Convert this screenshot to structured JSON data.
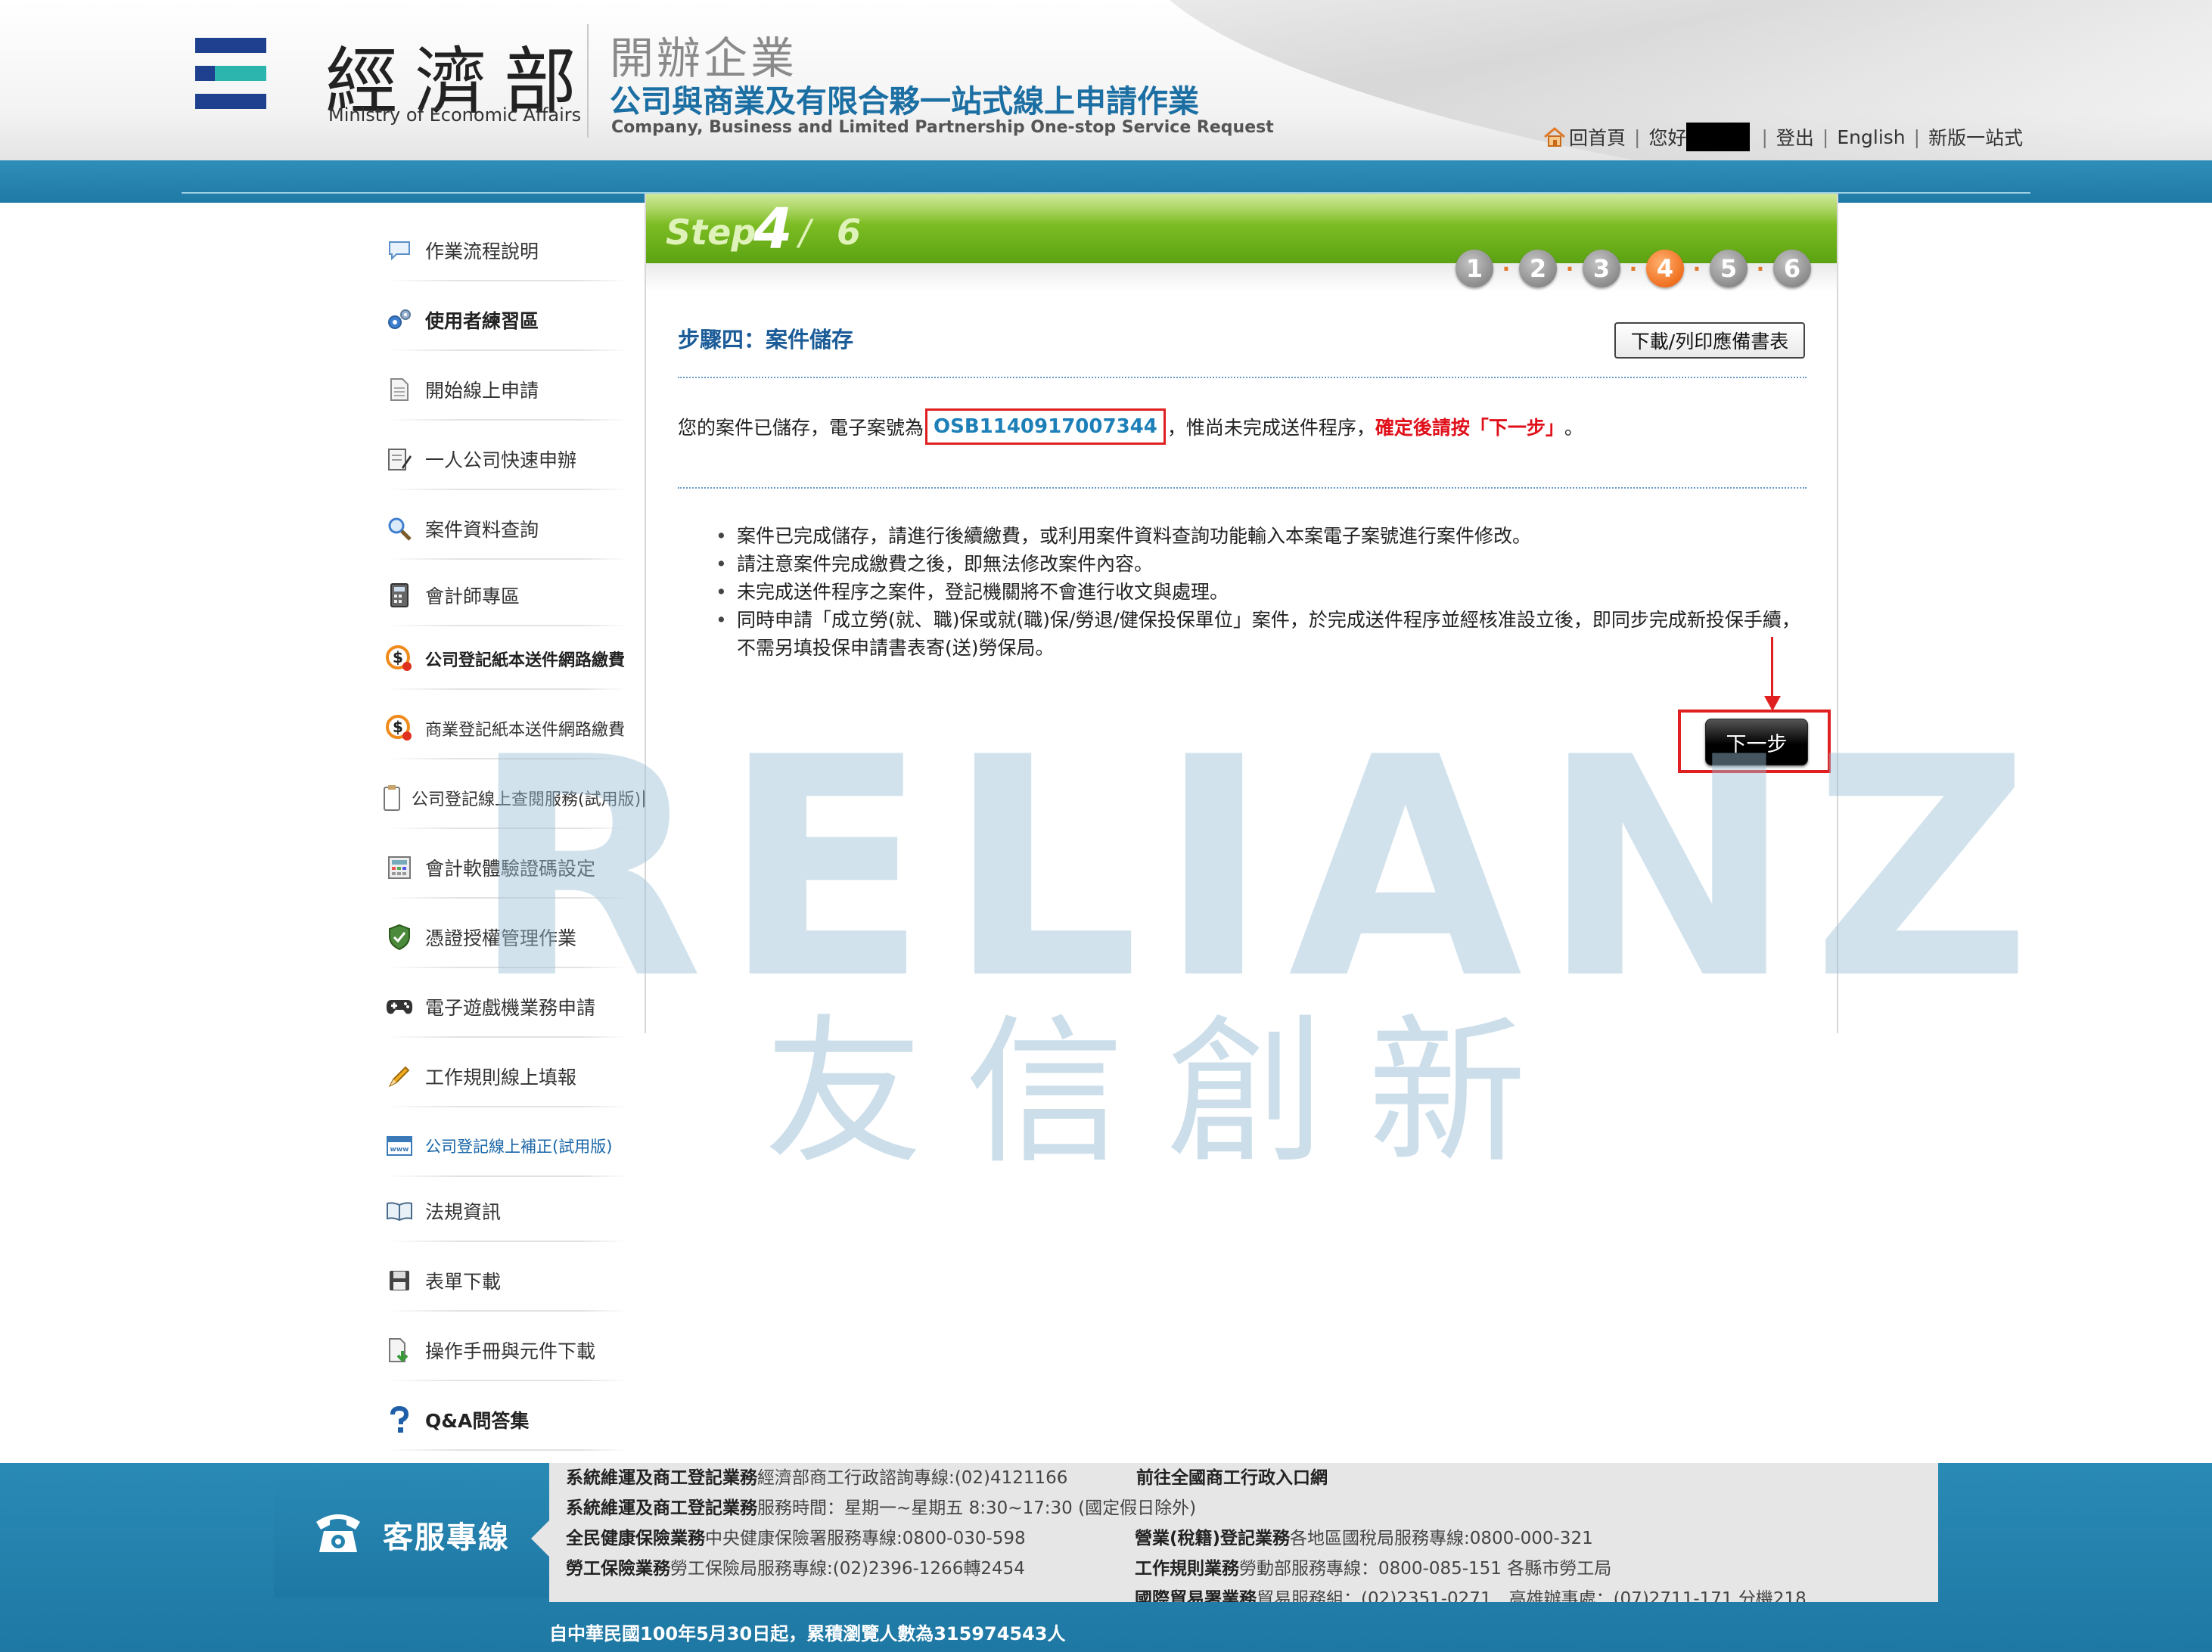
{
  "header": {
    "ministry_zh": "經濟部",
    "ministry_en": "Ministry of Economic Affairs",
    "subtitle_1": "開辦企業",
    "subtitle_2": "公司與商業及有限合夥一站式線上申請作業",
    "subtitle_3": "Company, Business and Limited Partnership One-stop Service Request",
    "logo_colors": {
      "navy": "#1f3f8f",
      "teal": "#2cb5ae"
    },
    "nav": {
      "home": "回首頁",
      "greeting": "您好",
      "logout": "登出",
      "english": "English",
      "new_version": "新版一站式",
      "separator": "|"
    }
  },
  "sidebar": {
    "items": [
      {
        "label": "作業流程說明",
        "icon": "speech-bubble-icon"
      },
      {
        "label": "使用者練習區",
        "icon": "gears-icon"
      },
      {
        "label": "開始線上申請",
        "icon": "document-icon"
      },
      {
        "label": "一人公司快速申辦",
        "icon": "form-edit-icon"
      },
      {
        "label": "案件資料查詢",
        "icon": "magnifier-icon"
      },
      {
        "label": "會計師專區",
        "icon": "calculator-icon"
      },
      {
        "label": "公司登記紙本送件網路繳費",
        "icon": "dollar-coin-icon"
      },
      {
        "label": "商業登記紙本送件網路繳費",
        "icon": "dollar-coin-icon"
      },
      {
        "label": "公司登記線上查閱服務(試用版)",
        "icon": "clipboard-icon"
      },
      {
        "label": "會計軟體驗證碼設定",
        "icon": "calculator-grid-icon"
      },
      {
        "label": "憑證授權管理作業",
        "icon": "shield-check-icon"
      },
      {
        "label": "電子遊戲機業務申請",
        "icon": "gamepad-icon"
      },
      {
        "label": "工作規則線上填報",
        "icon": "pencil-icon"
      },
      {
        "label": "公司登記線上補正(試用版)",
        "icon": "browser-window-icon"
      },
      {
        "label": "法規資訊",
        "icon": "open-book-icon"
      },
      {
        "label": "表單下載",
        "icon": "floppy-disk-icon"
      },
      {
        "label": "操作手冊與元件下載",
        "icon": "download-doc-icon"
      },
      {
        "label": "Q&A問答集",
        "icon": "question-mark-icon"
      }
    ]
  },
  "step": {
    "word": "Step",
    "current": "4",
    "slash": "/",
    "total": "6",
    "dots": [
      "1",
      "2",
      "3",
      "4",
      "5",
      "6"
    ],
    "active_index": 3,
    "dot_separator": "·"
  },
  "main": {
    "title": "步驟四：案件儲存",
    "download_button": "下載/列印應備書表",
    "msg_prefix": "您的案件已儲存，電子案號為",
    "case_number": "OSB1140917007344",
    "msg_middle": "，惟尚未完成送件程序，",
    "msg_red": "確定後請按「下一步」",
    "msg_end": "。",
    "notes": [
      "案件已完成儲存，請進行後續繳費，或利用案件資料查詢功能輸入本案電子案號進行案件修改。",
      "請注意案件完成繳費之後，即無法修改案件內容。",
      "未完成送件程序之案件，登記機關將不會進行收文與處理。",
      "同時申請「成立勞(就、職)保或就(職)保/勞退/健保投保單位」案件，於完成送件程序並經核准設立後，即同步完成新投保手續，不需另填投保申請書表寄(送)勞保局。"
    ],
    "next_button": "下一步",
    "highlight_color": "#e02020"
  },
  "watermark": {
    "en": "RELIANZ",
    "zh": "友信創新"
  },
  "footer": {
    "hotline_label": "客服專線",
    "rows": [
      {
        "bold": "系統維運及商工登記業務",
        "text": "經濟部商工行政諮詢專線:(02)4121166",
        "extra": "前往全國商工行政入口網"
      },
      {
        "bold": "系統維運及商工登記業務",
        "text": "服務時間：星期一~星期五 8:30~17:30 (國定假日除外)"
      },
      {
        "bold": "全民健康保險業務",
        "text": "中央健康保險署服務專線:0800-030-598",
        "bold2": "營業(稅籍)登記業務",
        "text2": "各地區國稅局服務專線:0800-000-321"
      },
      {
        "bold": "勞工保險業務",
        "text": "勞工保險局服務專線:(02)2396-1266轉2454",
        "bold2": "工作規則業務",
        "text2": "勞動部服務專線：0800-085-151 各縣市勞工局"
      },
      {
        "bold2": "國際貿易署業務",
        "text2": "貿易服務組：(02)2351-0271　高雄辦事處：(07)2711-171 分機218"
      }
    ],
    "visitor_count": "自中華民國100年5月30日起，累積瀏覽人數為315974543人"
  }
}
